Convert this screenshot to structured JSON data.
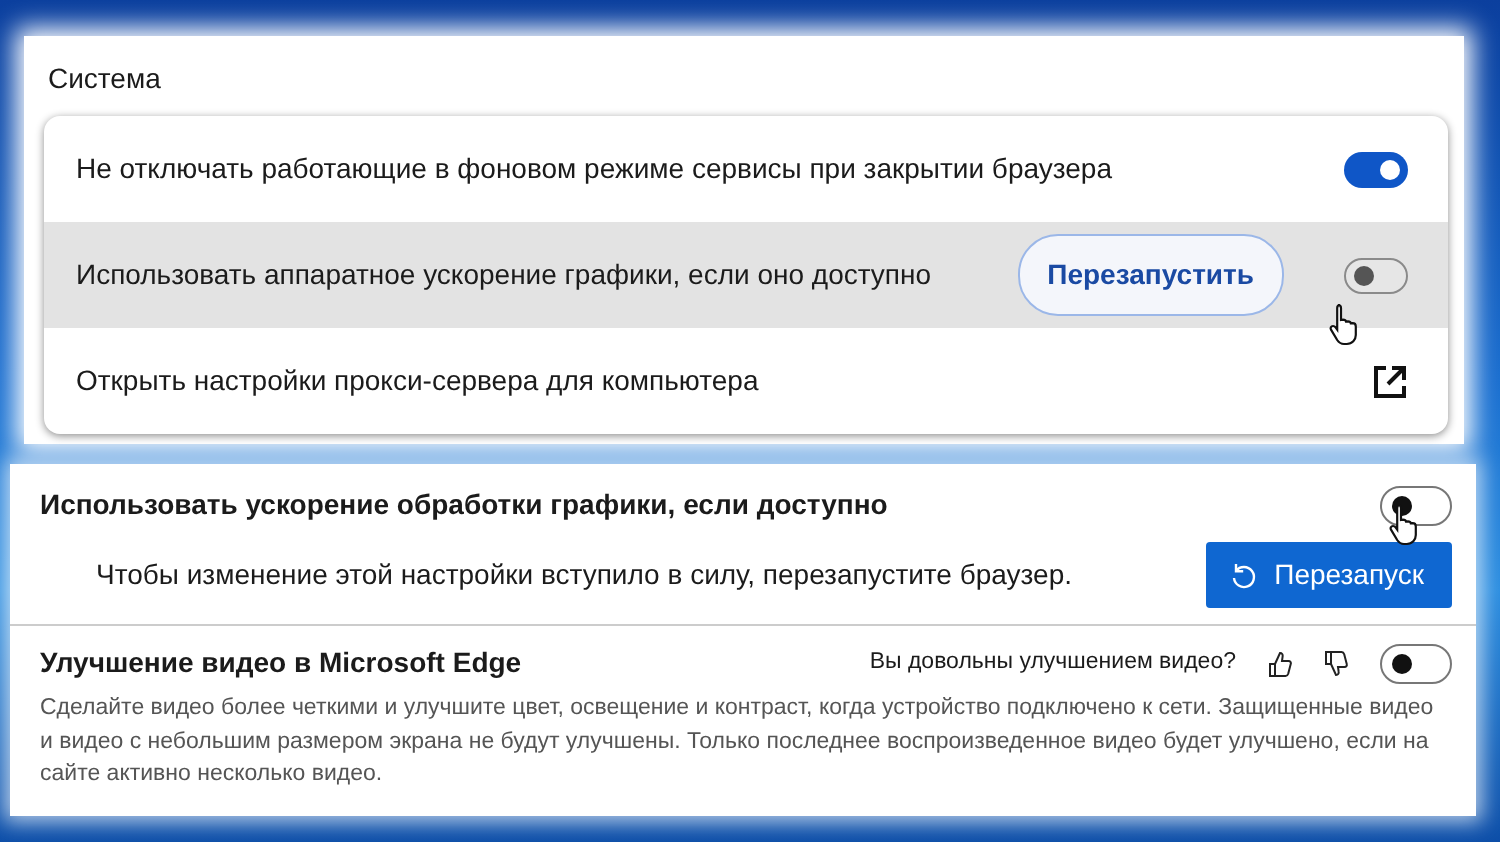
{
  "system_panel": {
    "title": "Система",
    "rows": [
      {
        "kind": "toggle",
        "label": "Не отключать работающие в фоновом режиме сервисы при закрытии браузера",
        "hovered": false,
        "on": true
      },
      {
        "kind": "toggle",
        "label": "Использовать аппаратное ускорение графики, если оно доступно",
        "hovered": true,
        "button": "Перезапустить",
        "on": false,
        "cursor": true
      },
      {
        "kind": "external-link",
        "label": "Открыть настройки прокси-сервера для компьютера",
        "hovered": false
      }
    ]
  },
  "graphics_panel": {
    "title": "Использовать ускорение обработки графики, если доступно",
    "on": false,
    "cursor": true,
    "notice": "Чтобы изменение этой настройки вступило в силу, перезапустите браузер.",
    "restart_button": "Перезапуск",
    "video": {
      "title": "Улучшение видео в Microsoft Edge",
      "feedback_question": "Вы довольны улучшением видео?",
      "on": false,
      "description": "Сделайте видео более четкими и улучшите цвет, освещение и контраст, когда устройство подключено к сети. Защищенные видео и видео с небольшим размером экрана не будут улучшены. Только последнее воспроизведенное видео будет улучшено, если на сайте активно несколько видео."
    }
  }
}
